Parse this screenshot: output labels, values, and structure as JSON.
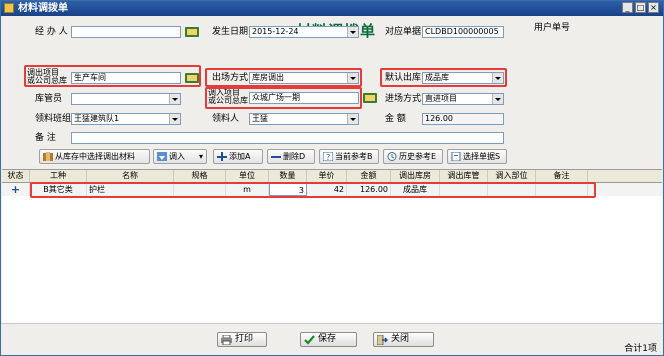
{
  "window": {
    "title": "材料调拨单",
    "minimize": "_",
    "maximize": "□",
    "close": "×"
  },
  "form": {
    "heading": "材料调拨单",
    "doc_number_label": "用户单号",
    "handler": {
      "label": "经 办 人",
      "value": ""
    },
    "source_project": {
      "label_line1": "调出项目",
      "label_line2": "或公司总库",
      "value": "生产车间"
    },
    "keeper": {
      "label": "库管员",
      "value": ""
    },
    "team": {
      "label": "领料班组",
      "value": "王猛建筑队1"
    },
    "note": {
      "label": "备    注",
      "value": ""
    },
    "date": {
      "label": "发生日期",
      "value": "2015-12-24"
    },
    "out_mode": {
      "label": "出场方式",
      "value": "库房调出"
    },
    "target_project": {
      "label_line1": "调入项目",
      "label_line2": "或公司总库",
      "value": "众城广场一期"
    },
    "receiver": {
      "label": "领料人",
      "value": "王猛"
    },
    "ref_doc": {
      "label": "对应单据",
      "value": "CLDBD100000005"
    },
    "default_out_store": {
      "label": "默认出库",
      "value": "成品库"
    },
    "in_mode": {
      "label": "进场方式",
      "value": "直进项目"
    },
    "amount": {
      "label": "金    额",
      "value": "126.00"
    }
  },
  "toolbar": {
    "select_from_stock": "从库存中选择调出材料",
    "import": "调入",
    "add": "添加A",
    "delete": "删除D",
    "current_ref": "当前参考B",
    "history_ref": "历史参考E",
    "choose_doc": "选择单据S"
  },
  "grid": {
    "headers": [
      "状态",
      "工种",
      "名称",
      "规格",
      "单位",
      "数量",
      "单价",
      "金额",
      "调出库房",
      "调出库管",
      "调入部位",
      "备注"
    ],
    "rows": [
      {
        "status": "+",
        "trade": "B其它类",
        "name": "护栏",
        "spec": "",
        "unit": "m",
        "qty": "3",
        "price": "42",
        "amount": "126.00",
        "out_store": "成品库",
        "out_keeper": "",
        "in_position": "",
        "remark": ""
      }
    ]
  },
  "footer": {
    "print": "打印",
    "save": "保存",
    "close": "关闭",
    "total": "合计1项"
  },
  "colors": {
    "title_green": "#0a6d3a",
    "highlight_red": "#e53b3b",
    "titlebar_blue": "#1a4188"
  }
}
